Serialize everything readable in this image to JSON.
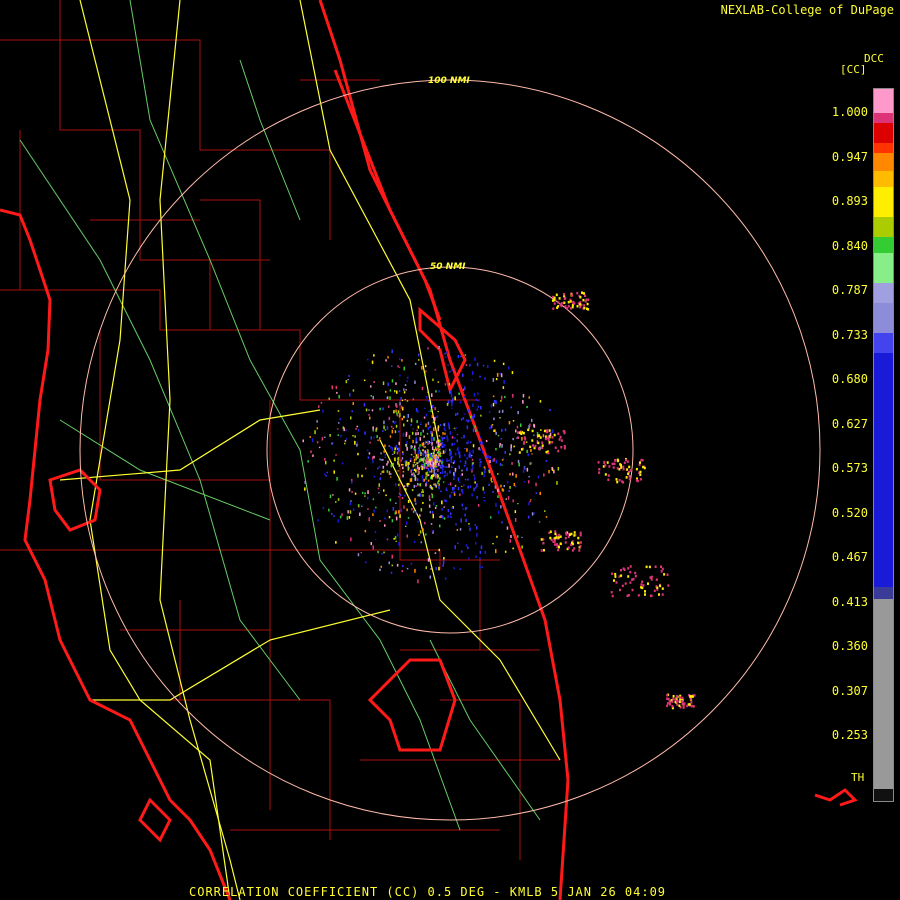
{
  "header": {
    "site_credit": "NEXLAB-College of DuPage",
    "product_code": "DCC",
    "product_unit": "[CC]"
  },
  "footer": {
    "caption": "CORRELATION COEFFICIENT (CC) 0.5 DEG - KMLB 5 JAN 26 04:09"
  },
  "range_rings": [
    "50 NMI",
    "100 NMI"
  ],
  "colorbar": {
    "labels": [
      "1.000",
      "0.947",
      "0.893",
      "0.840",
      "0.787",
      "0.733",
      "0.680",
      "0.627",
      "0.573",
      "0.520",
      "0.467",
      "0.413",
      "0.360",
      "0.307",
      "0.253"
    ],
    "bottom_label": "TH",
    "colors": {
      "low_gray": "#999999",
      "blue": "#1a1ad9",
      "light_purple": "#8c8cd9",
      "green": "#33cc33",
      "yellow": "#ffee00",
      "orange": "#ff8800",
      "red": "#dd0000",
      "pink": "#ff99cc"
    }
  },
  "map_colors": {
    "coastline": "#ff1a1a",
    "county_lines": "#aa1111",
    "highways": "#ffff33",
    "rivers": "#66cc66",
    "range_ring": "#ffbbaa"
  }
}
